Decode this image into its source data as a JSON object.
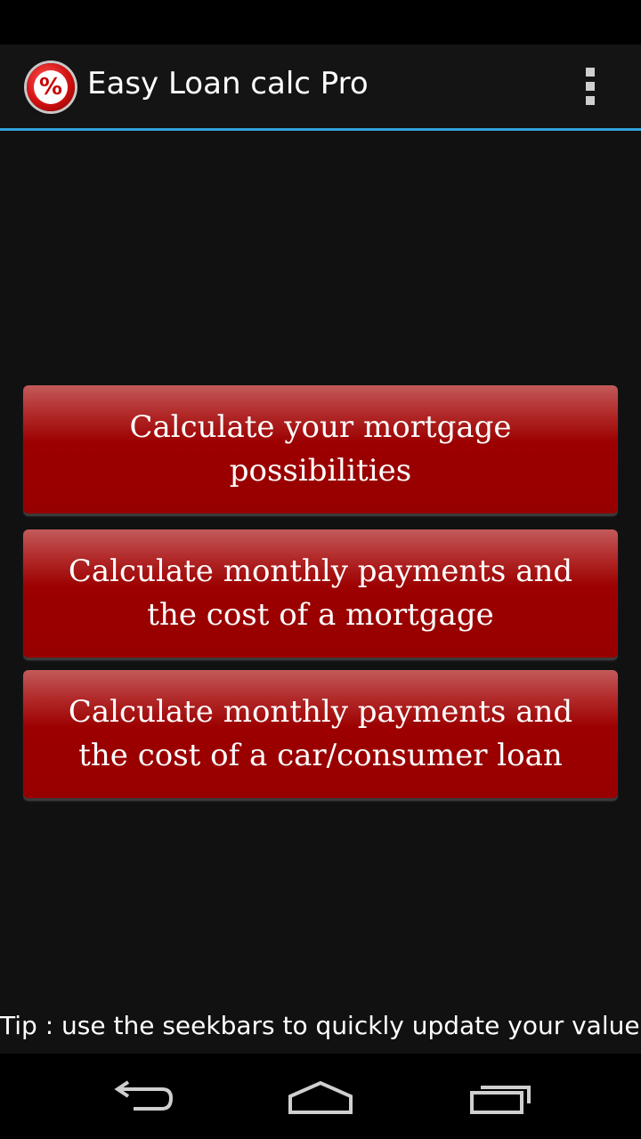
{
  "app": {
    "title": "Easy Loan calc Pro",
    "icon": "percent-icon",
    "icon_text": "%"
  },
  "menu": {
    "buttons": [
      {
        "label": "Calculate your mortgage possibilities"
      },
      {
        "label": "Calculate monthly payments and the cost of a mortgage"
      },
      {
        "label": "Calculate monthly payments and the cost of a car/consumer loan"
      }
    ]
  },
  "tip": "Tip : use the seekbars to quickly update your values",
  "nav": {
    "back_icon": "back-icon",
    "home_icon": "home-icon",
    "recents_icon": "recents-icon"
  },
  "colors": {
    "accent": "#33a3dc",
    "button": "#9c0000",
    "background": "#111111"
  }
}
